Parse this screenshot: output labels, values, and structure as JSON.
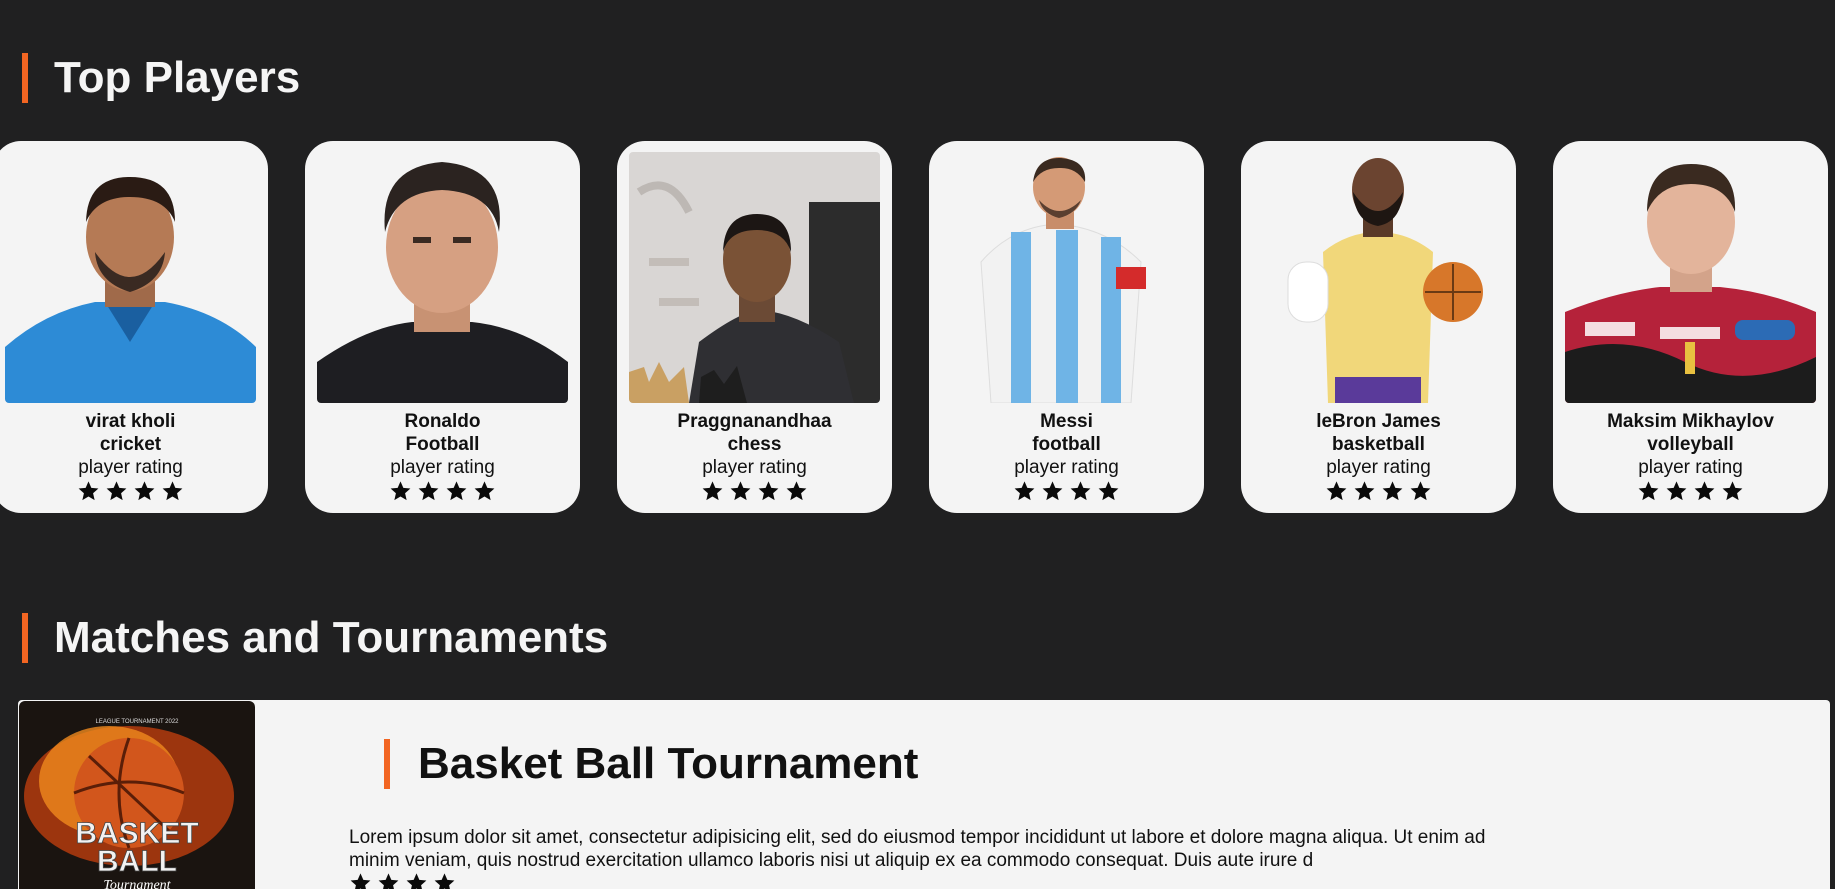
{
  "sections": {
    "players_title": "Top Players",
    "matches_title": "Matches and Tournaments"
  },
  "players": [
    {
      "name": "virat kholi",
      "sport": "cricket",
      "rating_label": "player rating",
      "stars": 4
    },
    {
      "name": "Ronaldo",
      "sport": "Football",
      "rating_label": "player rating",
      "stars": 4
    },
    {
      "name": "Praggnanandhaa",
      "sport": "chess",
      "rating_label": "player rating",
      "stars": 4
    },
    {
      "name": "Messi",
      "sport": "football",
      "rating_label": "player rating",
      "stars": 4
    },
    {
      "name": "leBron James",
      "sport": "basketball",
      "rating_label": "player rating",
      "stars": 4
    },
    {
      "name": "Maksim Mikhaylov",
      "sport": "volleyball",
      "rating_label": "player rating",
      "stars": 4
    }
  ],
  "tournament": {
    "title": "Basket Ball Tournament",
    "description": "Lorem ipsum dolor sit amet, consectetur adipisicing elit, sed do eiusmod tempor incididunt ut labore et dolore magna aliqua. Ut enim ad minim veniam, quis nostrud exercitation ullamco laboris nisi ut aliquip ex ea commodo consequat. Duis aute irure d",
    "stars": 4,
    "poster": {
      "top_text": "LEAGUE TOURNAMENT 2022",
      "line1": "BASKET",
      "line2": "BALL",
      "line3": "Tournament"
    }
  },
  "colors": {
    "background": "#202021",
    "accent": "#f26522",
    "card": "#f4f4f4"
  }
}
